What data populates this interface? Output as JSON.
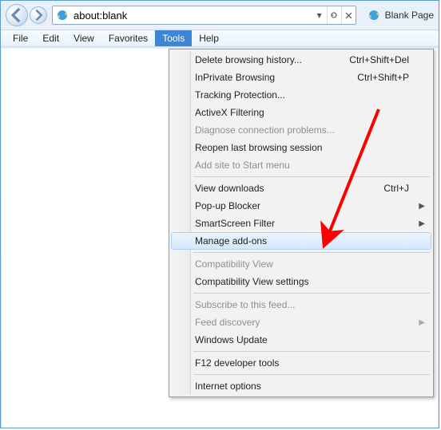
{
  "address": {
    "value": "about:blank"
  },
  "tab": {
    "title": "Blank Page"
  },
  "menubar": {
    "items": [
      "File",
      "Edit",
      "View",
      "Favorites",
      "Tools",
      "Help"
    ],
    "activeIndex": 4
  },
  "dropdown": {
    "items": [
      {
        "label": "Delete browsing history...",
        "shortcut": "Ctrl+Shift+Del"
      },
      {
        "label": "InPrivate Browsing",
        "shortcut": "Ctrl+Shift+P"
      },
      {
        "label": "Tracking Protection..."
      },
      {
        "label": "ActiveX Filtering"
      },
      {
        "label": "Diagnose connection problems...",
        "disabled": true
      },
      {
        "label": "Reopen last browsing session"
      },
      {
        "label": "Add site to Start menu",
        "disabled": true
      },
      {
        "sep": true
      },
      {
        "label": "View downloads",
        "shortcut": "Ctrl+J"
      },
      {
        "label": "Pop-up Blocker",
        "submenu": true
      },
      {
        "label": "SmartScreen Filter",
        "submenu": true
      },
      {
        "label": "Manage add-ons",
        "hover": true
      },
      {
        "sep": true
      },
      {
        "label": "Compatibility View",
        "disabled": true
      },
      {
        "label": "Compatibility View settings"
      },
      {
        "sep": true
      },
      {
        "label": "Subscribe to this feed...",
        "disabled": true
      },
      {
        "label": "Feed discovery",
        "disabled": true,
        "submenu": true
      },
      {
        "label": "Windows Update"
      },
      {
        "sep": true
      },
      {
        "label": "F12 developer tools"
      },
      {
        "sep": true
      },
      {
        "label": "Internet options"
      }
    ]
  },
  "annotation": {
    "arrow_color": "#ff0000"
  }
}
